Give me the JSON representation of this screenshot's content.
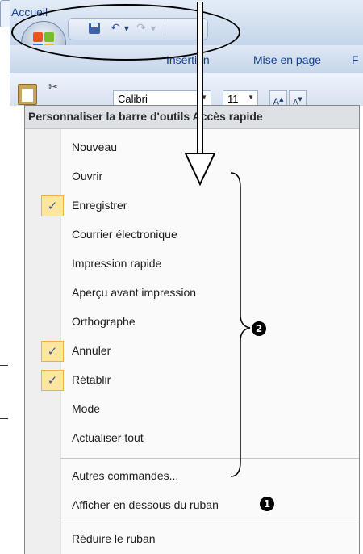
{
  "ribbon": {
    "tabs": [
      "Accueil",
      "Insertion",
      "Mise en page",
      "F"
    ],
    "font_name": "Calibri",
    "font_size": "11",
    "grow_label": "A",
    "shrink_label": "A"
  },
  "menu": {
    "title": "Personnaliser la barre d'outils Accès rapide",
    "items": [
      {
        "label": "Nouveau",
        "checked": false
      },
      {
        "label": "Ouvrir",
        "checked": false
      },
      {
        "label": "Enregistrer",
        "checked": true
      },
      {
        "label": "Courrier électronique",
        "checked": false
      },
      {
        "label": "Impression rapide",
        "checked": false
      },
      {
        "label": "Aperçu avant impression",
        "checked": false
      },
      {
        "label": "Orthographe",
        "checked": false
      },
      {
        "label": "Annuler",
        "checked": true
      },
      {
        "label": "Rétablir",
        "checked": true
      },
      {
        "label": "Mode",
        "checked": false
      },
      {
        "label": "Actualiser tout",
        "checked": false
      }
    ],
    "more_commands": "Autres commandes...",
    "show_below": "Afficher en dessous du ruban",
    "minimize": "Réduire le ruban"
  },
  "annotations": {
    "badge_1": "1",
    "badge_2": "2"
  },
  "colors": {
    "check_bg": "#ffe6a0",
    "check_border": "#f0b23a",
    "ribbon_text": "#15428b"
  }
}
